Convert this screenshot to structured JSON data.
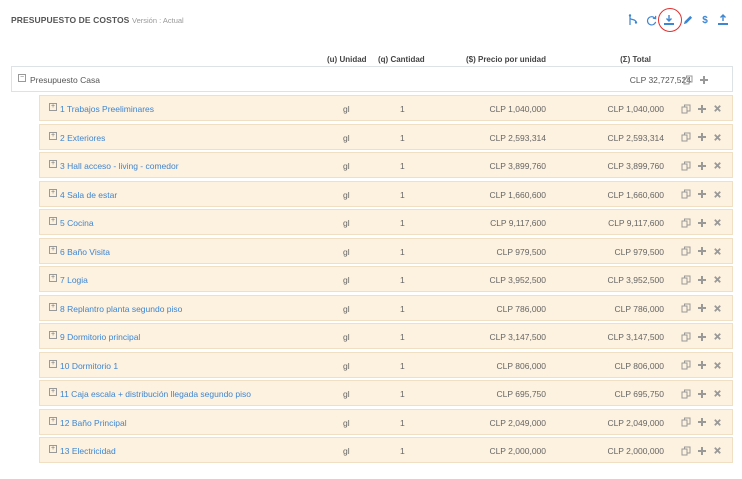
{
  "header": {
    "title": "PRESUPUESTO DE COSTOS",
    "version": "Versión : Actual"
  },
  "toolbar": {
    "icons": [
      "branch-icon",
      "refresh-icon",
      "download-icon",
      "edit-icon",
      "dollar-icon",
      "upload-icon"
    ],
    "dollar_label": "$",
    "highlight_color": "#e0312f",
    "accent": "#3d86d2"
  },
  "columns": {
    "unit": "(u) Unidad",
    "qty": "(q) Cantidad",
    "price": "($) Precio por unidad",
    "total": "(Σ) Total"
  },
  "root": {
    "label": "Presupuesto Casa",
    "total": "CLP 32,727,524"
  },
  "rows": [
    {
      "label": "1 Trabajos Preeliminares",
      "unit": "gl",
      "qty": "1",
      "price": "CLP 1,040,000",
      "total": "CLP 1,040,000"
    },
    {
      "label": "2 Exteriores",
      "unit": "gl",
      "qty": "1",
      "price": "CLP 2,593,314",
      "total": "CLP 2,593,314"
    },
    {
      "label": "3 Hall acceso - living - comedor",
      "unit": "gl",
      "qty": "1",
      "price": "CLP 3,899,760",
      "total": "CLP 3,899,760"
    },
    {
      "label": "4 Sala de estar",
      "unit": "gl",
      "qty": "1",
      "price": "CLP 1,660,600",
      "total": "CLP 1,660,600"
    },
    {
      "label": "5 Cocina",
      "unit": "gl",
      "qty": "1",
      "price": "CLP 9,117,600",
      "total": "CLP 9,117,600"
    },
    {
      "label": "6 Baño Visita",
      "unit": "gl",
      "qty": "1",
      "price": "CLP 979,500",
      "total": "CLP 979,500"
    },
    {
      "label": "7 Logia",
      "unit": "gl",
      "qty": "1",
      "price": "CLP 3,952,500",
      "total": "CLP 3,952,500"
    },
    {
      "label": "8 Replantro planta segundo piso",
      "unit": "gl",
      "qty": "1",
      "price": "CLP 786,000",
      "total": "CLP 786,000"
    },
    {
      "label": "9 Dormitorio principal",
      "unit": "gl",
      "qty": "1",
      "price": "CLP 3,147,500",
      "total": "CLP 3,147,500"
    },
    {
      "label": "10 Dormitorio 1",
      "unit": "gl",
      "qty": "1",
      "price": "CLP 806,000",
      "total": "CLP 806,000"
    },
    {
      "label": "11 Caja escala + distribución llegada segundo piso",
      "unit": "gl",
      "qty": "1",
      "price": "CLP 695,750",
      "total": "CLP 695,750"
    },
    {
      "label": "12 Baño Principal",
      "unit": "gl",
      "qty": "1",
      "price": "CLP 2,049,000",
      "total": "CLP 2,049,000"
    },
    {
      "label": "13 Electricidad",
      "unit": "gl",
      "qty": "1",
      "price": "CLP 2,000,000",
      "total": "CLP 2,000,000"
    }
  ]
}
